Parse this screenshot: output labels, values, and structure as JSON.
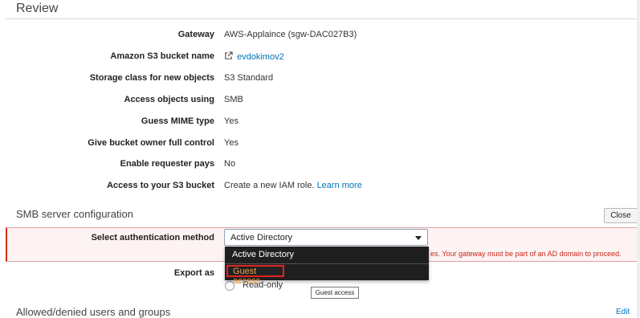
{
  "review": {
    "title": "Review",
    "rows": [
      {
        "label": "Gateway",
        "value": "AWS-Applaince (sgw-DAC027B3)"
      },
      {
        "label": "Amazon S3 bucket name",
        "value": "evdokimov2",
        "icon": "external-link-icon"
      },
      {
        "label": "Storage class for new objects",
        "value": "S3 Standard"
      },
      {
        "label": "Access objects using",
        "value": "SMB"
      },
      {
        "label": "Guess MIME type",
        "value": "Yes"
      },
      {
        "label": "Give bucket owner full control",
        "value": "Yes"
      },
      {
        "label": "Enable requester pays",
        "value": "No"
      },
      {
        "label": "Access to your S3 bucket",
        "value": "Create a new IAM role.",
        "link": "Learn more"
      }
    ]
  },
  "smb": {
    "title": "SMB server configuration",
    "close_label": "Close",
    "auth_label": "Select authentication method",
    "auth_selected": "Active Directory",
    "error_text": "es. Your gateway must be part of an AD domain to proceed.",
    "dropdown_options": [
      "Active Directory",
      "Guest access"
    ],
    "export_label": "Export as",
    "export_option": "Read-only",
    "tooltip": "Guest access"
  },
  "users": {
    "title": "Allowed/denied users and groups",
    "edit_label": "Edit"
  },
  "colors": {
    "link": "#0073bb",
    "error": "#c7261c",
    "highlight": "#e02424",
    "dropdown_bg": "#1f1f1f",
    "guest_text": "#f0a04b"
  }
}
